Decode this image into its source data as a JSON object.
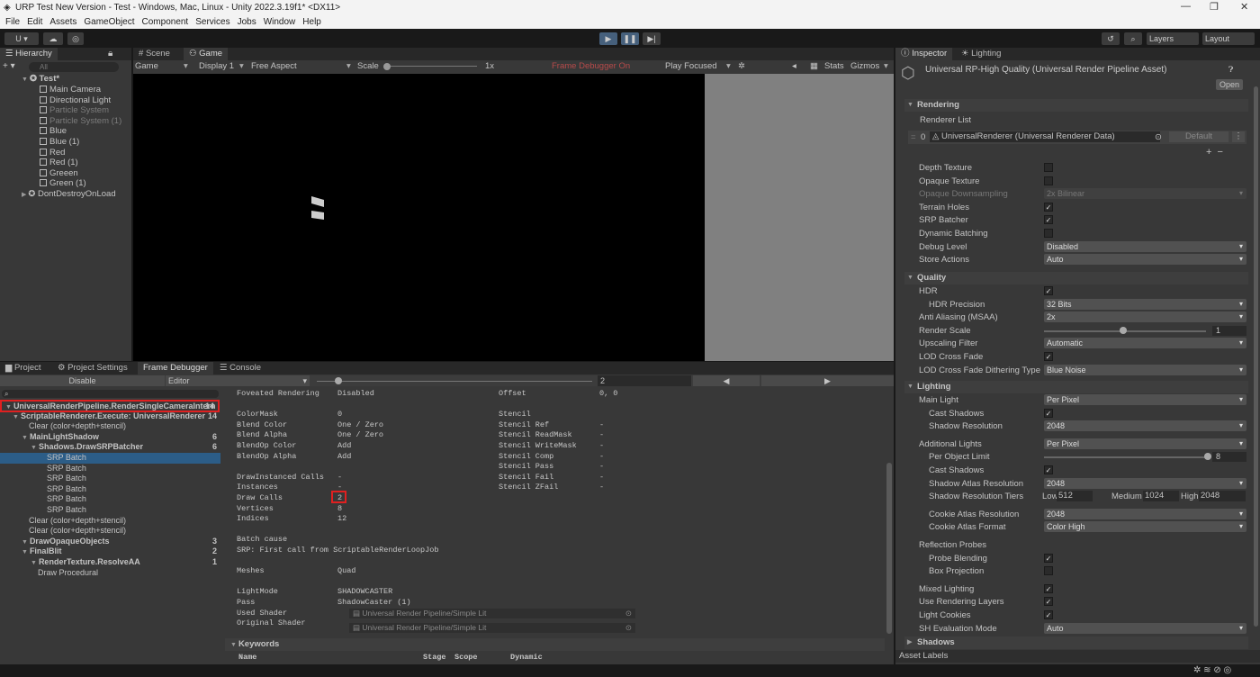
{
  "window": {
    "title": "URP Test New Version - Test - Windows, Mac, Linux - Unity 2022.3.19f1* <DX11>"
  },
  "menu": [
    "File",
    "Edit",
    "Assets",
    "GameObject",
    "Component",
    "Services",
    "Jobs",
    "Window",
    "Help"
  ],
  "toolbar": {
    "account": "U ▾",
    "layers": "Layers",
    "layout": "Layout"
  },
  "hierarchy": {
    "tab": "Hierarchy",
    "search_placeholder": "All",
    "scene": "Test*",
    "items": [
      "Main Camera",
      "Directional Light",
      "Particle System",
      "Particle System (1)",
      "Blue",
      "Blue (1)",
      "Red",
      "Red (1)",
      "Greeen",
      "Green (1)"
    ],
    "dont_destroy": "DontDestroyOnLoad"
  },
  "view_tabs": {
    "scene": "Scene",
    "game": "Game"
  },
  "game_toolbar": {
    "mode": "Game",
    "display": "Display 1",
    "aspect": "Free Aspect",
    "scale_label": "Scale",
    "scale_value": "1x",
    "frame_debugger": "Frame Debugger On",
    "play_focused": "Play Focused",
    "stats": "Stats",
    "gizmos": "Gizmos"
  },
  "bottom_tabs": {
    "project": "Project",
    "project_settings": "Project Settings",
    "frame_debugger": "Frame Debugger",
    "console": "Console"
  },
  "fd": {
    "disable": "Disable",
    "editor": "Editor",
    "frame_value": "2",
    "tree": [
      {
        "label": "UniversalRenderPipeline.RenderSingleCameraIntern",
        "count": "14",
        "indent": 0,
        "bold": true
      },
      {
        "label": "ScriptableRenderer.Execute: UniversalRenderer",
        "count": "14",
        "indent": 1,
        "bold": true
      },
      {
        "label": "Clear (color+depth+stencil)",
        "count": "",
        "indent": 2,
        "bold": false
      },
      {
        "label": "MainLightShadow",
        "count": "6",
        "indent": 2,
        "bold": true
      },
      {
        "label": "Shadows.DrawSRPBatcher",
        "count": "6",
        "indent": 3,
        "bold": true
      },
      {
        "label": "SRP Batch",
        "count": "",
        "indent": 4,
        "bold": false
      },
      {
        "label": "SRP Batch",
        "count": "",
        "indent": 4,
        "bold": false
      },
      {
        "label": "SRP Batch",
        "count": "",
        "indent": 4,
        "bold": false
      },
      {
        "label": "SRP Batch",
        "count": "",
        "indent": 4,
        "bold": false
      },
      {
        "label": "SRP Batch",
        "count": "",
        "indent": 4,
        "bold": false
      },
      {
        "label": "SRP Batch",
        "count": "",
        "indent": 4,
        "bold": false
      },
      {
        "label": "Clear (color+depth+stencil)",
        "count": "",
        "indent": 2,
        "bold": false
      },
      {
        "label": "Clear (color+depth+stencil)",
        "count": "",
        "indent": 2,
        "bold": false
      },
      {
        "label": "DrawOpaqueObjects",
        "count": "3",
        "indent": 2,
        "bold": true
      },
      {
        "label": "FinalBlit",
        "count": "2",
        "indent": 2,
        "bold": true
      },
      {
        "label": "RenderTexture.ResolveAA",
        "count": "1",
        "indent": 3,
        "bold": true
      },
      {
        "label": "Draw Procedural",
        "count": "",
        "indent": 3,
        "bold": false
      }
    ],
    "details_left": [
      [
        "Foveated Rendering",
        "Disabled"
      ],
      [
        "",
        ""
      ],
      [
        "ColorMask",
        "0"
      ],
      [
        "Blend Color",
        "One / Zero"
      ],
      [
        "Blend Alpha",
        "One / Zero"
      ],
      [
        "BlendOp Color",
        "Add"
      ],
      [
        "BlendOp Alpha",
        "Add"
      ],
      [
        "",
        ""
      ],
      [
        "DrawInstanced Calls",
        "-"
      ],
      [
        "Instances",
        "-"
      ],
      [
        "Draw Calls",
        "2"
      ],
      [
        "Vertices",
        "8"
      ],
      [
        "Indices",
        "12"
      ],
      [
        "",
        ""
      ],
      [
        "Batch cause",
        ""
      ],
      [
        "SRP: First call from ScriptableRenderLoopJob",
        ""
      ],
      [
        "",
        ""
      ],
      [
        "Meshes",
        "Quad"
      ],
      [
        "",
        ""
      ],
      [
        "LightMode",
        "SHADOWCASTER"
      ],
      [
        "Pass",
        "ShadowCaster (1)"
      ],
      [
        "Used Shader",
        ""
      ],
      [
        "Original Shader",
        ""
      ]
    ],
    "details_right": [
      [
        "Offset",
        "0, 0"
      ],
      [
        "",
        ""
      ],
      [
        "Stencil",
        ""
      ],
      [
        "Stencil Ref",
        "-"
      ],
      [
        "Stencil ReadMask",
        "-"
      ],
      [
        "Stencil WriteMask",
        "-"
      ],
      [
        "Stencil Comp",
        "-"
      ],
      [
        "Stencil Pass",
        "-"
      ],
      [
        "Stencil Fail",
        "-"
      ],
      [
        "Stencil ZFail",
        "-"
      ]
    ],
    "used_shader": "Universal Render Pipeline/Simple Lit",
    "original_shader": "Universal Render Pipeline/Simple Lit",
    "keywords": "Keywords",
    "kw_cols": [
      "Name",
      "Stage",
      "Scope",
      "Dynamic"
    ]
  },
  "inspector": {
    "tab": "Inspector",
    "lighting_tab": "Lighting",
    "asset_title": "Universal RP-High Quality (Universal Render Pipeline Asset)",
    "open": "Open",
    "rendering": "Rendering",
    "renderer_list": "Renderer List",
    "renderer_index": "0",
    "renderer_name": "UniversalRenderer (Universal Renderer Data)",
    "default": "Default",
    "rows": [
      {
        "label": "Depth Texture",
        "type": "check",
        "value": ""
      },
      {
        "label": "Opaque Texture",
        "type": "check",
        "value": ""
      },
      {
        "label": "Opaque Downsampling",
        "type": "drop",
        "value": "2x Bilinear",
        "disabled": true
      },
      {
        "label": "Terrain Holes",
        "type": "check",
        "value": "✓"
      },
      {
        "label": "SRP Batcher",
        "type": "check",
        "value": "✓"
      },
      {
        "label": "Dynamic Batching",
        "type": "check",
        "value": ""
      },
      {
        "label": "Debug Level",
        "type": "drop",
        "value": "Disabled"
      },
      {
        "label": "Store Actions",
        "type": "drop",
        "value": "Auto"
      }
    ],
    "quality": "Quality",
    "quality_rows": [
      {
        "label": "HDR",
        "type": "check",
        "value": "✓"
      },
      {
        "label": "HDR Precision",
        "type": "drop",
        "value": "32 Bits",
        "indent": true
      },
      {
        "label": "Anti Aliasing (MSAA)",
        "type": "drop",
        "value": "2x"
      },
      {
        "label": "Render Scale",
        "type": "slider",
        "value": "1"
      },
      {
        "label": "Upscaling Filter",
        "type": "drop",
        "value": "Automatic"
      },
      {
        "label": "LOD Cross Fade",
        "type": "check",
        "value": "✓"
      },
      {
        "label": "LOD Cross Fade Dithering Type",
        "type": "drop",
        "value": "Blue Noise"
      }
    ],
    "lighting": "Lighting",
    "lighting_rows": [
      {
        "label": "Main Light",
        "type": "drop",
        "value": "Per Pixel"
      },
      {
        "label": "Cast Shadows",
        "type": "check",
        "value": "✓",
        "indent": true
      },
      {
        "label": "Shadow Resolution",
        "type": "drop",
        "value": "2048",
        "indent": true
      },
      {
        "label": "Additional Lights",
        "type": "drop",
        "value": "Per Pixel",
        "gap": true
      },
      {
        "label": "Per Object Limit",
        "type": "slider",
        "value": "8",
        "indent": true
      },
      {
        "label": "Cast Shadows",
        "type": "check",
        "value": "✓",
        "indent": true
      },
      {
        "label": "Shadow Atlas Resolution",
        "type": "drop",
        "value": "2048",
        "indent": true
      },
      {
        "label": "Shadow Resolution Tiers",
        "type": "tiers",
        "value": "",
        "indent": true
      },
      {
        "label": "Cookie Atlas Resolution",
        "type": "drop",
        "value": "2048",
        "indent": true,
        "gap": true
      },
      {
        "label": "Cookie Atlas Format",
        "type": "drop",
        "value": "Color High",
        "indent": true
      },
      {
        "label": "Reflection Probes",
        "type": "none",
        "value": "",
        "gap": true
      },
      {
        "label": "Probe Blending",
        "type": "check",
        "value": "✓",
        "indent": true
      },
      {
        "label": "Box Projection",
        "type": "check",
        "value": "",
        "indent": true
      },
      {
        "label": "Mixed Lighting",
        "type": "check",
        "value": "✓",
        "gap": true
      },
      {
        "label": "Use Rendering Layers",
        "type": "check",
        "value": "✓"
      },
      {
        "label": "Light Cookies",
        "type": "check",
        "value": "✓"
      },
      {
        "label": "SH Evaluation Mode",
        "type": "drop",
        "value": "Auto"
      }
    ],
    "tiers": {
      "low": "Low",
      "low_v": "512",
      "med": "Medium",
      "med_v": "1024",
      "high": "High",
      "high_v": "2048"
    },
    "shadows": "Shadows",
    "asset_labels": "Asset Labels"
  }
}
